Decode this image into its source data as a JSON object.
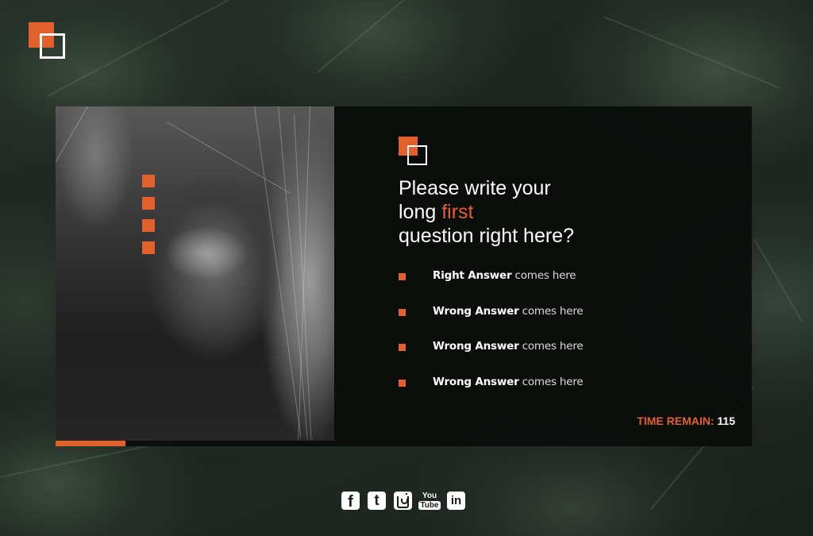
{
  "colors": {
    "accent": "#e2602c",
    "panel": "#080908",
    "text": "#ffffff"
  },
  "question": {
    "line1": "Please write your",
    "line2_prefix": "long ",
    "line2_accent": "first",
    "line3": "question right here?"
  },
  "answers": [
    {
      "strong": "Right Answer",
      "rest": " comes here"
    },
    {
      "strong": "Wrong Answer",
      "rest": " comes here"
    },
    {
      "strong": "Wrong Answer",
      "rest": " comes here"
    },
    {
      "strong": "Wrong Answer",
      "rest": " comes here"
    }
  ],
  "timer": {
    "label": "TIME REMAIN: ",
    "value": "115"
  },
  "social": {
    "facebook": "f",
    "tumblr": "t",
    "youtube_top": "You",
    "youtube_bottom": "Tube",
    "linkedin": "in"
  }
}
